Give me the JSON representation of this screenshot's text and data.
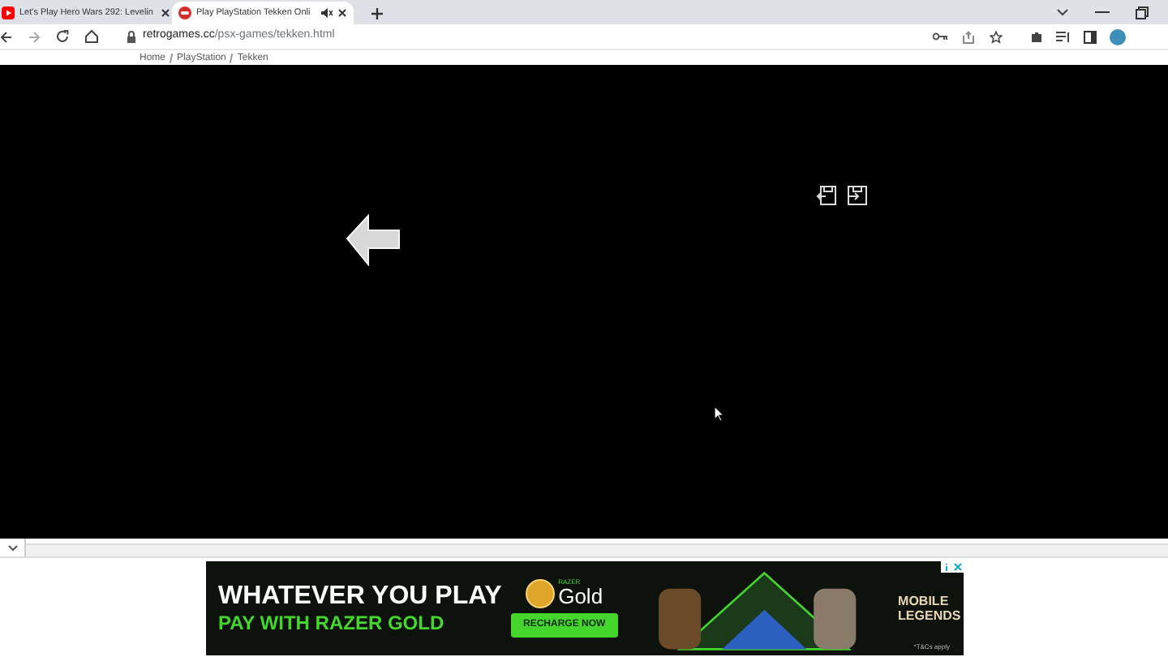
{
  "tabs": [
    {
      "title": "Let's Play Hero Wars 292: Levelin",
      "selected": false,
      "kind": "video",
      "muted": false
    },
    {
      "title": "Play PlayStation Tekken Onli",
      "selected": true,
      "kind": "game",
      "muted": true
    }
  ],
  "address_bar": {
    "url": "retrogames.cc",
    "path": "/psx-games/tekken.html"
  },
  "breadcrumb": [
    "Home",
    "PlayStation",
    "Tekken"
  ],
  "ad": {
    "headline": "WHATEVER YOU PLAY",
    "subline": "PAY WITH RAZER GOLD",
    "brand_small": "RAZER",
    "brand": "Gold",
    "button": "RECHARGE NOW",
    "game_logo": "MOBILE LEGENDS",
    "footnote": "*T&Cs apply"
  }
}
